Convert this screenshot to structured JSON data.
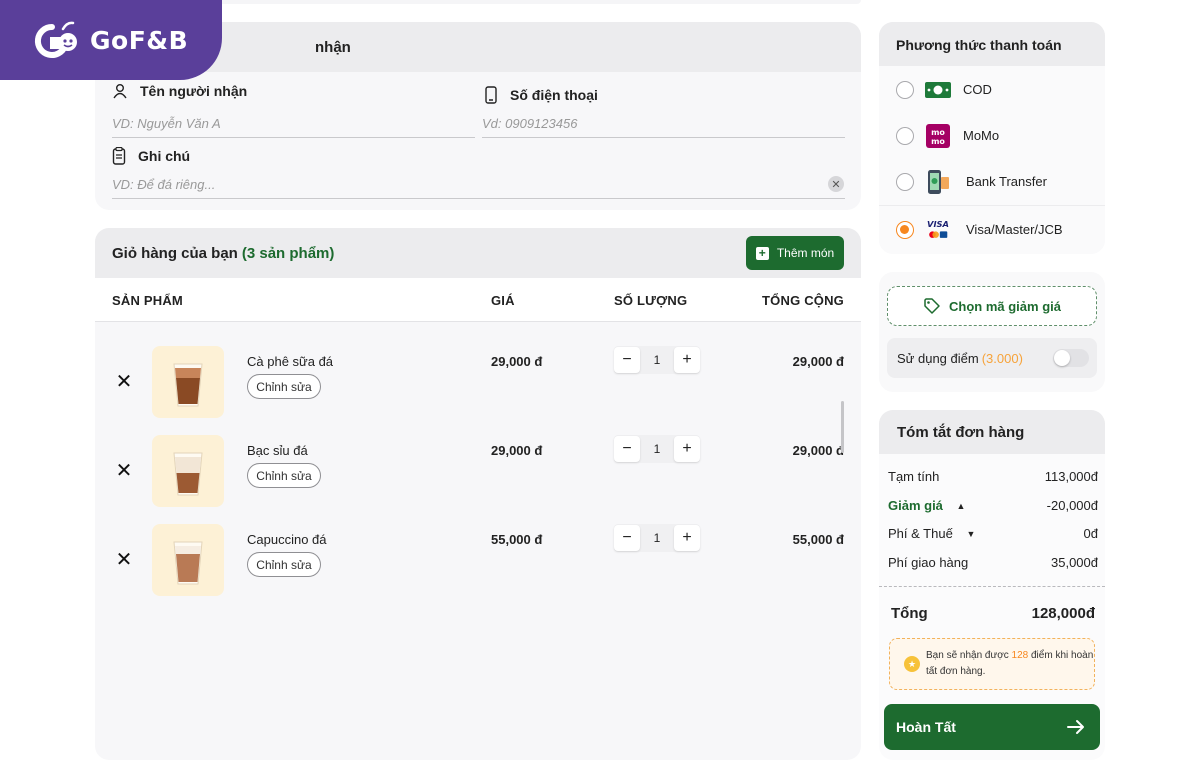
{
  "brand": {
    "logo_text": "GoF&B"
  },
  "recipient": {
    "title_visible": "nhận",
    "name_label": "Tên người nhận",
    "name_placeholder": "VD: Nguyễn Văn A",
    "phone_label": "Số điện thoại",
    "phone_placeholder": "Vd: 0909123456",
    "note_label": "Ghi chú",
    "note_placeholder": "VD: Để đá riêng..."
  },
  "cart": {
    "title": "Giỏ hàng của bạn",
    "count_text": "(3 sản phẩm)",
    "add_label": "Thêm món",
    "columns": {
      "product": "SẢN PHẨM",
      "price": "GIÁ",
      "qty": "SỐ LƯỢNG",
      "total": "TỔNG CỘNG"
    },
    "items": [
      {
        "name": "Cà phê sữa đá",
        "edit": "Chỉnh sửa",
        "price": "29,000 đ",
        "qty": "1",
        "total": "29,000 đ"
      },
      {
        "name": "Bạc sỉu đá",
        "edit": "Chỉnh sửa",
        "price": "29,000 đ",
        "qty": "1",
        "total": "29,000 đ"
      },
      {
        "name": "Capuccino đá",
        "edit": "Chỉnh sửa",
        "price": "55,000 đ",
        "qty": "1",
        "total": "55,000 đ"
      }
    ]
  },
  "payment": {
    "title": "Phương thức thanh toán",
    "options": [
      {
        "label": "COD",
        "icon": "cash-icon",
        "selected": false
      },
      {
        "label": "MoMo",
        "icon": "momo-icon",
        "selected": false
      },
      {
        "label": "Bank Transfer",
        "icon": "bank-transfer-icon",
        "selected": false
      },
      {
        "label": "Visa/Master/JCB",
        "icon": "visa-card-icon",
        "selected": true
      }
    ]
  },
  "discount": {
    "coupon_label": "Chọn mã giảm giá",
    "points_label": "Sử dụng điểm",
    "points_value": "(3.000)",
    "points_enabled": false
  },
  "summary": {
    "title": "Tóm tắt đơn hàng",
    "subtotal_label": "Tạm tính",
    "subtotal": "113,000đ",
    "discount_label": "Giảm giá",
    "discount": "-20,000đ",
    "fee_label": "Phí & Thuế",
    "fee": "0đ",
    "shipping_label": "Phí giao hàng",
    "shipping": "35,000đ",
    "total_label": "Tổng",
    "total": "128,000đ",
    "reward_prefix": "Bạn sẽ nhận được",
    "reward_points": "128",
    "reward_suffix": "điểm khi hoàn tất đơn hàng."
  },
  "checkout": {
    "label": "Hoàn Tất"
  },
  "colors": {
    "brand_purple": "#5a3f9a",
    "primary_green": "#1d6b2f",
    "accent_orange": "#f7871f"
  }
}
